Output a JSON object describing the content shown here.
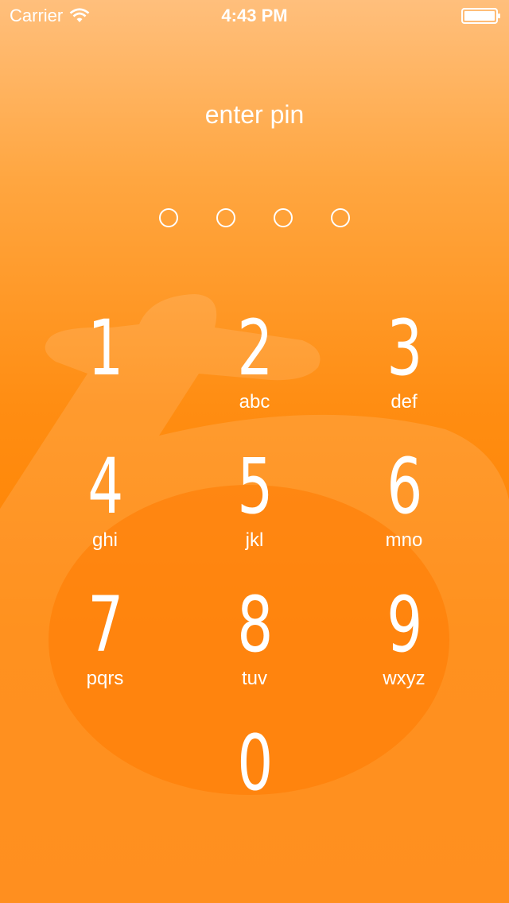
{
  "status_bar": {
    "carrier": "Carrier",
    "time": "4:43 PM",
    "icons": [
      "wifi-icon",
      "battery-icon"
    ]
  },
  "lock_screen": {
    "prompt": "enter pin",
    "pin_length": 4,
    "pin_entered": 0
  },
  "keypad": {
    "keys": [
      {
        "digit": "1",
        "letters": ""
      },
      {
        "digit": "2",
        "letters": "abc"
      },
      {
        "digit": "3",
        "letters": "def"
      },
      {
        "digit": "4",
        "letters": "ghi"
      },
      {
        "digit": "5",
        "letters": "jkl"
      },
      {
        "digit": "6",
        "letters": "mno"
      },
      {
        "digit": "7",
        "letters": "pqrs"
      },
      {
        "digit": "8",
        "letters": "tuv"
      },
      {
        "digit": "9",
        "letters": "wxyz"
      },
      {
        "digit": "0",
        "letters": ""
      }
    ]
  },
  "theme": {
    "background_top": "#ffbf7c",
    "background_bottom": "#ff8000",
    "foreground": "#ffffff"
  }
}
